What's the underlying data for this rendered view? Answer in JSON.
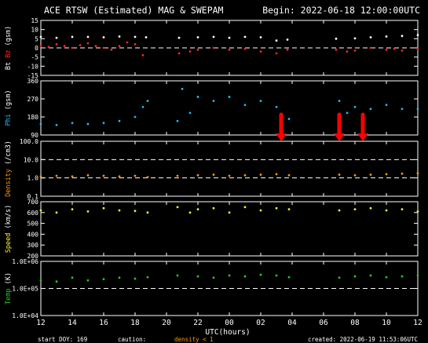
{
  "header": {
    "title": "ACE RTSW (Estimated) MAG & SWEPAM",
    "begin": "Begin: 2022-06-18 12:00:00UTC"
  },
  "footer": {
    "start_doy": "start DOY: 169",
    "caution_label": "caution:",
    "caution_value": "density < 1",
    "created": "created: 2022-06-19 11:53:06UTC"
  },
  "x_axis": {
    "label": "UTC(hours)",
    "ticks": [
      "12",
      "14",
      "16",
      "18",
      "20",
      "22",
      "00",
      "02",
      "04",
      "06",
      "08",
      "10",
      "12"
    ]
  },
  "colors": {
    "bt": "#ffffff",
    "bz": "#ff2222",
    "phi": "#22bbee",
    "density": "#ff9900",
    "speed": "#ffee33",
    "temp": "#22cc22",
    "arrow": "#ff0000",
    "frame": "#ffffff",
    "background": "#000000"
  },
  "chart_data": [
    {
      "type": "scatter",
      "title": "",
      "xlabel": "",
      "ylabel": "Bt Bz (gsm)",
      "ylabel_parts": [
        {
          "text": "Bt",
          "color": "#ffffff"
        },
        {
          "text": "Bz",
          "color": "#ff2222"
        },
        {
          "text": "(gsm)",
          "color": "#ffffff"
        }
      ],
      "ylim": [
        -15,
        15
      ],
      "yticks": [
        "15",
        "10",
        "5",
        "0",
        "-5",
        "-10",
        "-15"
      ],
      "ytick_values": [
        15,
        10,
        5,
        0,
        -5,
        -10,
        -15
      ],
      "dashed_lines": [
        0
      ],
      "series": [
        {
          "name": "Bt",
          "x": [
            0,
            1,
            2,
            3,
            4,
            5,
            6,
            6.7,
            8.8,
            10,
            11,
            12,
            13,
            14,
            15,
            15.7,
            18.8,
            20,
            21,
            22,
            23,
            24
          ],
          "y": [
            6,
            5.5,
            6,
            6,
            5.8,
            6.2,
            6,
            5.8,
            5.5,
            5.8,
            6,
            5.5,
            6,
            5.8,
            4,
            4.5,
            5,
            5.2,
            5.8,
            6.2,
            6.5,
            7
          ]
        },
        {
          "name": "Bz",
          "x": [
            0,
            0.5,
            1,
            1.5,
            2,
            2.5,
            3,
            3.5,
            4,
            4.5,
            5,
            5.5,
            6,
            6.5,
            8.8,
            9.5,
            10,
            11,
            12,
            13,
            14,
            15,
            15.7,
            18.8,
            19.5,
            20,
            21,
            22,
            22.5,
            23,
            24
          ],
          "y": [
            1,
            0.5,
            2,
            1,
            0,
            1.5,
            2.5,
            1,
            0,
            -1,
            1,
            3,
            2,
            -4,
            -3,
            -2,
            -1,
            0,
            -1,
            -0.5,
            -2,
            -3,
            -1,
            -1,
            -2,
            -1.5,
            0,
            -1,
            -0.5,
            -1.5,
            -0.5
          ]
        }
      ]
    },
    {
      "type": "scatter",
      "title": "",
      "xlabel": "",
      "ylabel": "Phi (gsm)",
      "ylabel_parts": [
        {
          "text": "Phi",
          "color": "#22bbee"
        },
        {
          "text": "(gsm)",
          "color": "#ffffff"
        }
      ],
      "ylim": [
        90,
        360
      ],
      "yticks": [
        "360",
        "270",
        "180",
        "90"
      ],
      "ytick_values": [
        360,
        270,
        180,
        90
      ],
      "dashed_lines": [],
      "series": [
        {
          "name": "Phi",
          "x": [
            0,
            1,
            2,
            3,
            4,
            5,
            6,
            6.5,
            6.8,
            8.7,
            9,
            9.5,
            10,
            11,
            12,
            13,
            14,
            15,
            15.8,
            19,
            19.5,
            20,
            21,
            22,
            23,
            24
          ],
          "y": [
            145,
            140,
            150,
            145,
            150,
            160,
            180,
            230,
            260,
            160,
            320,
            200,
            280,
            260,
            280,
            240,
            260,
            230,
            170,
            260,
            200,
            230,
            220,
            240,
            220,
            220
          ]
        }
      ]
    },
    {
      "type": "scatter",
      "title": "",
      "xlabel": "",
      "ylabel": "Density (/cm3)",
      "ylabel_parts": [
        {
          "text": "Density",
          "color": "#ff9900"
        },
        {
          "text": "(/cm3)",
          "color": "#ffffff"
        }
      ],
      "yscale": "log",
      "ylim": [
        0.1,
        100
      ],
      "yticks": [
        "100.0",
        "10.0",
        "1.0",
        "0.1"
      ],
      "ytick_values": [
        100,
        10,
        1,
        0.1
      ],
      "dashed_lines": [
        10,
        1
      ],
      "series": [
        {
          "name": "Density",
          "x": [
            0,
            1,
            2,
            3,
            4,
            5,
            6,
            6.8,
            8.7,
            10,
            11,
            12,
            13,
            14,
            15,
            15.8,
            19,
            20,
            21,
            22,
            23,
            24
          ],
          "y": [
            1.2,
            1.3,
            1.2,
            1.4,
            1.3,
            1.2,
            1.3,
            1.1,
            1.3,
            1.4,
            1.5,
            1.3,
            1.4,
            1.5,
            1.6,
            1.4,
            1.5,
            1.4,
            1.5,
            1.6,
            1.7,
            1.8
          ]
        }
      ]
    },
    {
      "type": "scatter",
      "title": "",
      "xlabel": "",
      "ylabel": "Speed (km/s)",
      "ylabel_parts": [
        {
          "text": "Speed",
          "color": "#ffee33"
        },
        {
          "text": "(km/s)",
          "color": "#ffffff"
        }
      ],
      "ylim": [
        200,
        700
      ],
      "yticks": [
        "700",
        "600",
        "500",
        "400",
        "300",
        "200"
      ],
      "ytick_values": [
        700,
        600,
        500,
        400,
        300,
        200
      ],
      "dashed_lines": [],
      "series": [
        {
          "name": "Speed",
          "x": [
            0,
            1,
            2,
            3,
            4,
            5,
            6,
            6.8,
            8.7,
            9.5,
            10,
            11,
            12,
            13,
            14,
            15,
            15.8,
            19,
            20,
            21,
            22,
            23,
            24
          ],
          "y": [
            620,
            600,
            630,
            610,
            640,
            620,
            615,
            600,
            650,
            600,
            630,
            640,
            600,
            650,
            620,
            640,
            630,
            620,
            630,
            640,
            620,
            630,
            610
          ]
        }
      ]
    },
    {
      "type": "scatter",
      "title": "",
      "xlabel": "",
      "ylabel": "Temp (K)",
      "ylabel_parts": [
        {
          "text": "Temp",
          "color": "#22cc22"
        },
        {
          "text": "(K)",
          "color": "#ffffff"
        }
      ],
      "yscale": "log",
      "ylim": [
        10000,
        1000000
      ],
      "yticks": [
        "1.0E+06",
        "1.0E+05",
        "1.0E+04"
      ],
      "ytick_values": [
        1000000,
        100000,
        10000
      ],
      "dashed_lines": [
        100000
      ],
      "series": [
        {
          "name": "Temp",
          "x": [
            0,
            1,
            2,
            3,
            4,
            5,
            6,
            6.8,
            8.7,
            10,
            11,
            12,
            13,
            14,
            15,
            15.8,
            19,
            20,
            21,
            22,
            23,
            24
          ],
          "y": [
            200000,
            180000,
            250000,
            200000,
            220000,
            250000,
            230000,
            260000,
            300000,
            280000,
            250000,
            300000,
            280000,
            320000,
            300000,
            260000,
            250000,
            280000,
            300000,
            260000,
            280000,
            300000
          ]
        }
      ]
    }
  ],
  "annotations": {
    "arrow_hours": [
      15.3,
      19.0,
      20.5
    ],
    "arrow_levels": [
      0.2,
      0.05,
      0.05
    ]
  }
}
